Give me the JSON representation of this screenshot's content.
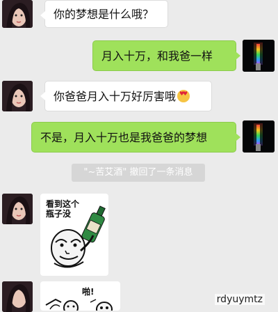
{
  "messages": [
    {
      "side": "left",
      "text": "你的梦想是什么哦？"
    },
    {
      "side": "right",
      "text": "月入十万，和我爸一样"
    },
    {
      "side": "left",
      "text": "你爸爸月入十万好厉害哦",
      "emoji": "heart-eyes-emoji"
    },
    {
      "side": "right",
      "text": "不是，月入十万也是我爸爸的梦想"
    }
  ],
  "system": {
    "quoted_name": "\"~苦艾酒\"",
    "recalled_text": " 撤回了一条消息"
  },
  "stickers": [
    {
      "caption_line1": "看到这个",
      "caption_line2": "瓶子没"
    },
    {
      "caption": "啪!"
    }
  ],
  "watermark": "rdyuymtz",
  "colors": {
    "background": "#ebebeb",
    "bubble_sent": "#9fe15b",
    "bubble_received": "#ffffff",
    "system_notice": "#d6d6d6"
  },
  "icons": {
    "friend_avatar": "girl-portrait",
    "my_avatar": "lightsaber",
    "sticker_bottle": "meme-face-with-bottle",
    "sticker_slap": "meme-faces-slapping"
  }
}
